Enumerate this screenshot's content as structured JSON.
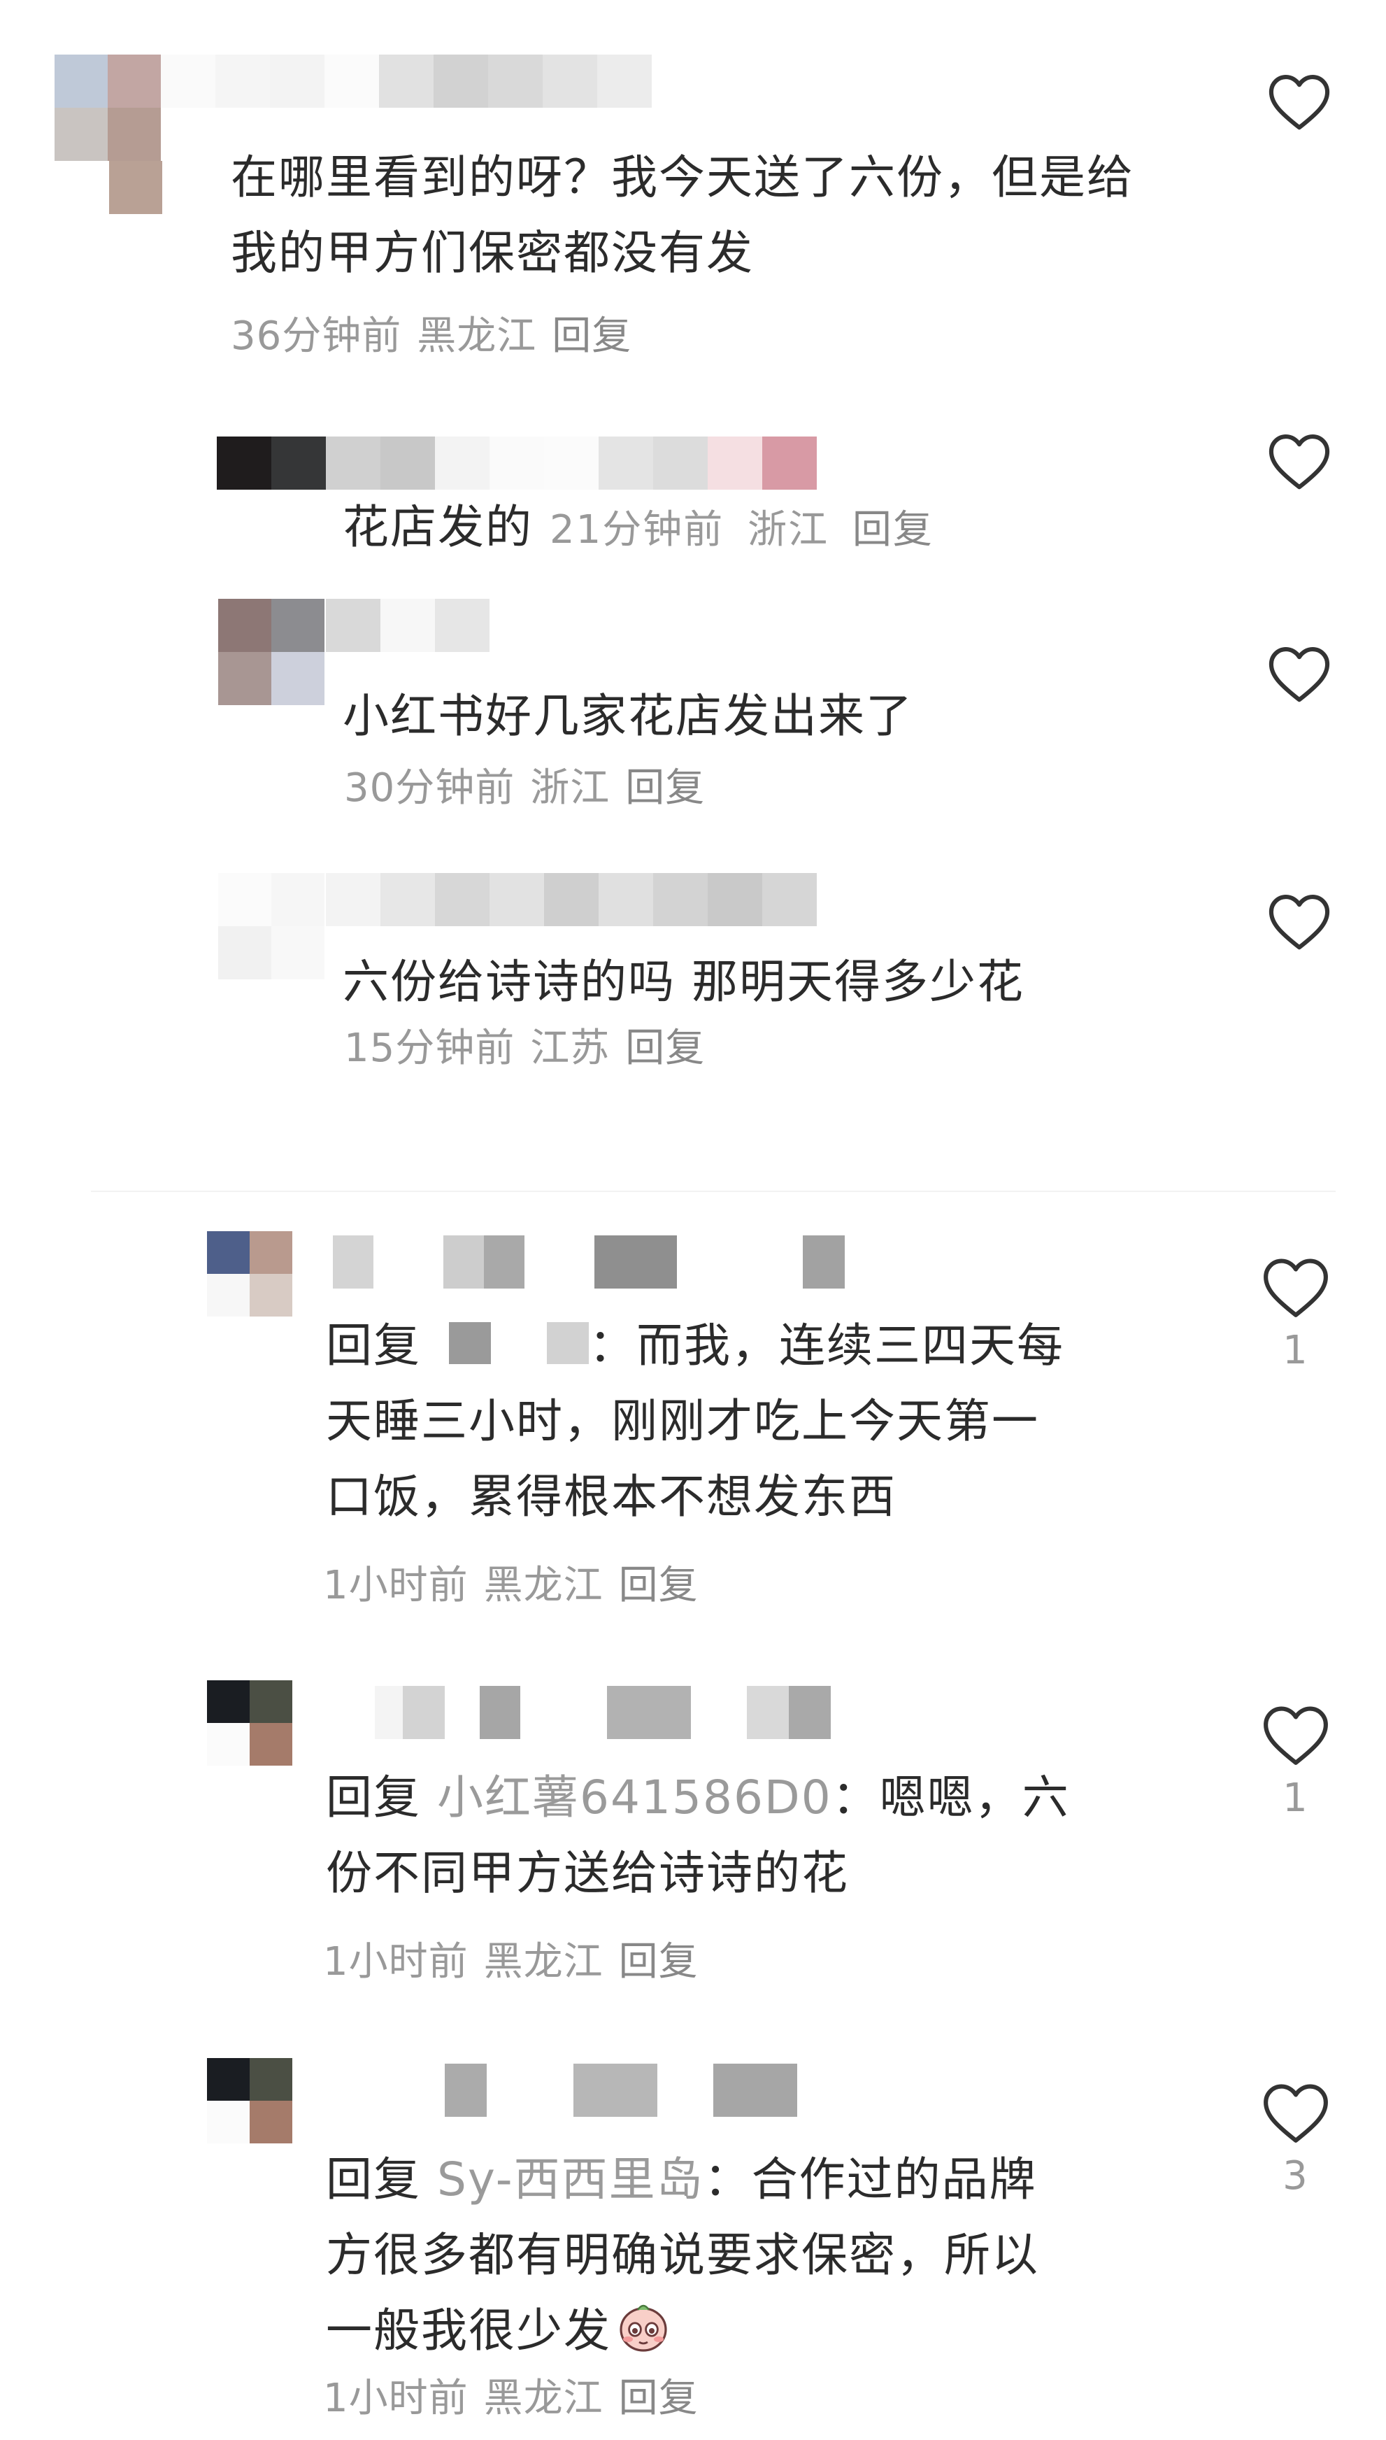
{
  "comments": [
    {
      "text_lines": [
        "在哪里看到的呀？我今天送了六份，但是给",
        "我的甲方们保密都没有发"
      ],
      "time": "36分钟前",
      "location": "黑龙江",
      "reply_label": "回复"
    },
    {
      "text": "花店发的",
      "time": "21分钟前",
      "location": "浙江",
      "reply_label": "回复"
    },
    {
      "text": "小红书好几家花店发出来了",
      "time": "30分钟前",
      "location": "浙江",
      "reply_label": "回复"
    },
    {
      "text": "六份给诗诗的吗 那明天得多少花",
      "time": "15分钟前",
      "location": "江苏",
      "reply_label": "回复"
    },
    {
      "reply_prefix": "回复",
      "line1_after_mention": "：而我，连续三四天每",
      "text_lines": [
        "天睡三小时，刚刚才吃上今天第一",
        "口饭，累得根本不想发东西"
      ],
      "time": "1小时前",
      "location": "黑龙江",
      "reply_label": "回复",
      "likes": "1"
    },
    {
      "reply_prefix": "回复",
      "mention": "小红薯641586D0",
      "line1_after_mention": "：嗯嗯，六",
      "text_lines": [
        "份不同甲方送给诗诗的花"
      ],
      "time": "1小时前",
      "location": "黑龙江",
      "reply_label": "回复",
      "likes": "1"
    },
    {
      "reply_prefix": "回复",
      "mention": "Sy-西西里岛",
      "line1_after_mention": "：合作过的品牌",
      "text_lines": [
        "方很多都有明确说要求保密，所以",
        "一般我很少发"
      ],
      "time": "1小时前",
      "location": "黑龙江",
      "reply_label": "回复",
      "likes": "3"
    }
  ],
  "icons": {
    "like": "heart-outline-icon",
    "emoji": "shy-face-emoji-icon"
  },
  "colors": {
    "text": "#2b2b2b",
    "meta": "#999999",
    "heart_stroke": "#333333",
    "emoji_pink": "#f4a6a6"
  }
}
